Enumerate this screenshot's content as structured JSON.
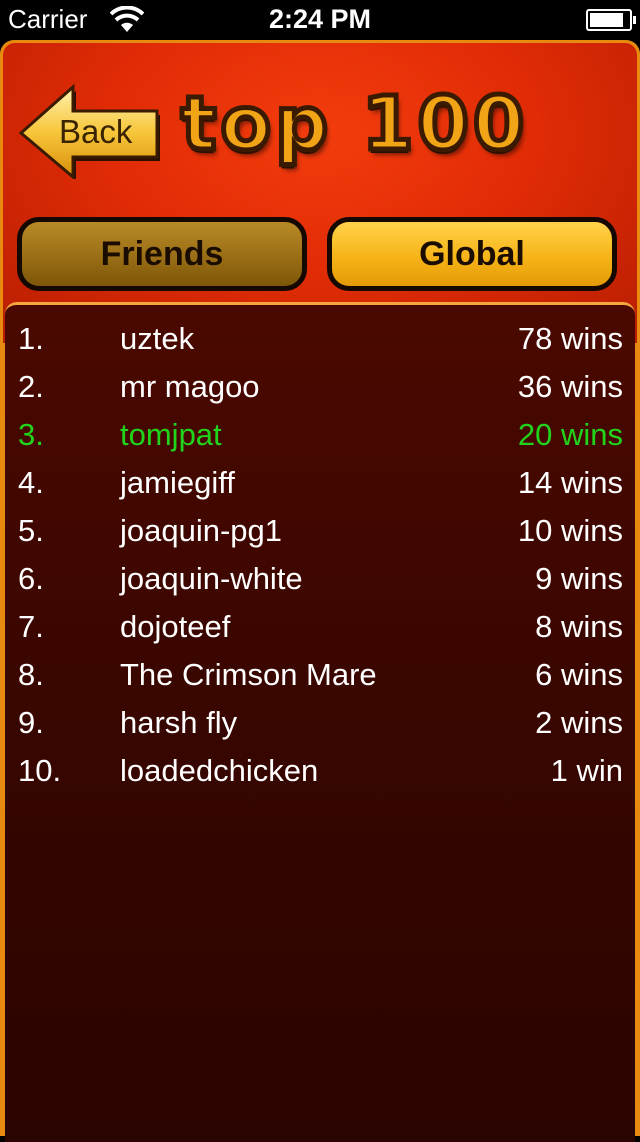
{
  "status_bar": {
    "carrier": "Carrier",
    "time": "2:24 PM"
  },
  "header": {
    "back_label": "Back",
    "title": "top 100"
  },
  "tabs": [
    {
      "label": "Friends",
      "selected": false
    },
    {
      "label": "Global",
      "selected": true
    }
  ],
  "leaderboard": [
    {
      "rank": "1.",
      "name": "uztek",
      "wins": "78 wins",
      "highlight": false
    },
    {
      "rank": "2.",
      "name": "mr magoo",
      "wins": "36 wins",
      "highlight": false
    },
    {
      "rank": "3.",
      "name": "tomjpat",
      "wins": "20 wins",
      "highlight": true
    },
    {
      "rank": "4.",
      "name": "jamiegiff",
      "wins": "14 wins",
      "highlight": false
    },
    {
      "rank": "5.",
      "name": "joaquin-pg1",
      "wins": "10 wins",
      "highlight": false
    },
    {
      "rank": "6.",
      "name": "joaquin-white",
      "wins": "9 wins",
      "highlight": false
    },
    {
      "rank": "7.",
      "name": "dojoteef",
      "wins": "8 wins",
      "highlight": false
    },
    {
      "rank": "8.",
      "name": "The Crimson Mare",
      "wins": "6 wins",
      "highlight": false
    },
    {
      "rank": "9.",
      "name": "harsh fly",
      "wins": "2 wins",
      "highlight": false
    },
    {
      "rank": "10.",
      "name": "loadedchicken",
      "wins": "1 win",
      "highlight": false
    }
  ],
  "colors": {
    "header_red": "#e22c06",
    "frame_orange": "#e88a10",
    "highlight_green": "#22d31c",
    "panel_dark": "#3a0600"
  }
}
